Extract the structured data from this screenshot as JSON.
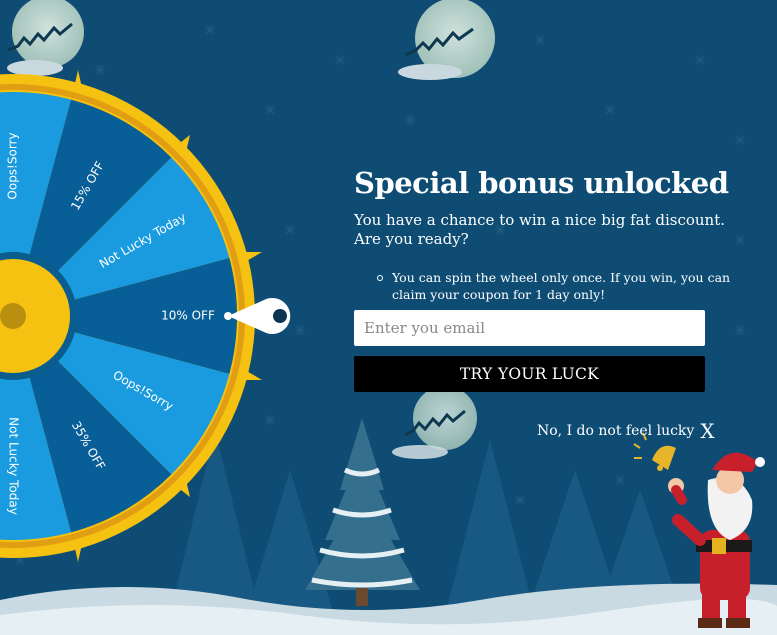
{
  "wheel": {
    "segments": [
      {
        "label": "Oops!Sorry"
      },
      {
        "label": "15% OFF"
      },
      {
        "label": "Not Lucky Today"
      },
      {
        "label": "10% OFF"
      },
      {
        "label": "Oops!Sorry"
      },
      {
        "label": "35% OFF"
      },
      {
        "label": "Not Lucky Today"
      }
    ]
  },
  "panel": {
    "title": "Special bonus unlocked",
    "subtitle": "You have a chance to win a nice big fat discount. Are you ready?",
    "notes": [
      "You can spin the wheel only once. If you win, you can claim your coupon for 1 day only!"
    ]
  },
  "form": {
    "email_placeholder": "Enter you email",
    "submit_label": "TRY YOUR LUCK"
  },
  "decline": {
    "label": "No, I do not feel lucky",
    "close_glyph": "X"
  },
  "colors": {
    "background": "#0e4c74",
    "wheel_light": "#1a9be0",
    "wheel_dark": "#085e96",
    "wheel_rim": "#f5c211",
    "button": "#000000"
  }
}
